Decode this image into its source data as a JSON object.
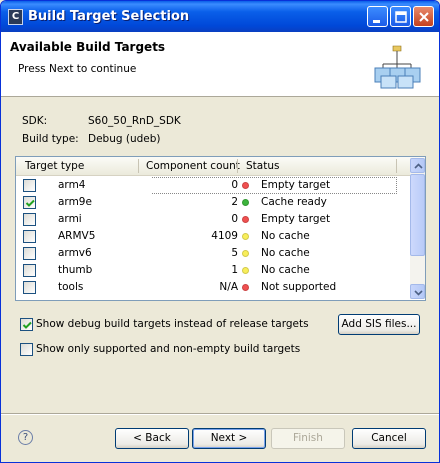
{
  "window": {
    "title": "Build Target Selection",
    "app_icon_glyph": "C"
  },
  "header": {
    "title": "Available Build Targets",
    "subtitle": "Press Next to continue"
  },
  "info": {
    "sdk_label": "SDK:",
    "sdk_value": "S60_50_RnD_SDK",
    "build_type_label": "Build type:",
    "build_type_value": "Debug (udeb)"
  },
  "table": {
    "columns": [
      "Target type",
      "Component count",
      "Status"
    ],
    "rows": [
      {
        "name": "arm4",
        "count": "0",
        "status": "Empty target",
        "checked": false,
        "status_color": "#f05050"
      },
      {
        "name": "arm9e",
        "count": "2",
        "status": "Cache ready",
        "checked": true,
        "status_color": "#3cb43c"
      },
      {
        "name": "armi",
        "count": "0",
        "status": "Empty target",
        "checked": false,
        "status_color": "#f05050"
      },
      {
        "name": "ARMV5",
        "count": "4109",
        "status": "No cache",
        "checked": false,
        "status_color": "#f8ee5a"
      },
      {
        "name": "armv6",
        "count": "5",
        "status": "No cache",
        "checked": false,
        "status_color": "#f8ee5a"
      },
      {
        "name": "thumb",
        "count": "1",
        "status": "No cache",
        "checked": false,
        "status_color": "#f8ee5a"
      },
      {
        "name": "tools",
        "count": "N/A",
        "status": "Not supported",
        "checked": false,
        "status_color": "#f05050"
      }
    ]
  },
  "options": {
    "show_debug_label": "Show debug build targets instead of release targets",
    "show_debug_checked": true,
    "show_supported_label": "Show only supported and non-empty build targets",
    "show_supported_checked": false,
    "add_sis_label": "Add SIS files..."
  },
  "buttons": {
    "back": "< Back",
    "next": "Next >",
    "finish": "Finish",
    "cancel": "Cancel",
    "help_glyph": "?"
  },
  "colors": {
    "titlebar": "#0a5fe9",
    "dialog_bg": "#ece9d8",
    "focus_border": "#7aa2ea"
  },
  "icons": [
    "app-icon",
    "minimize-icon",
    "maximize-icon",
    "close-icon",
    "wizard-banner-icon",
    "help-icon",
    "checkbox-checked-icon"
  ]
}
